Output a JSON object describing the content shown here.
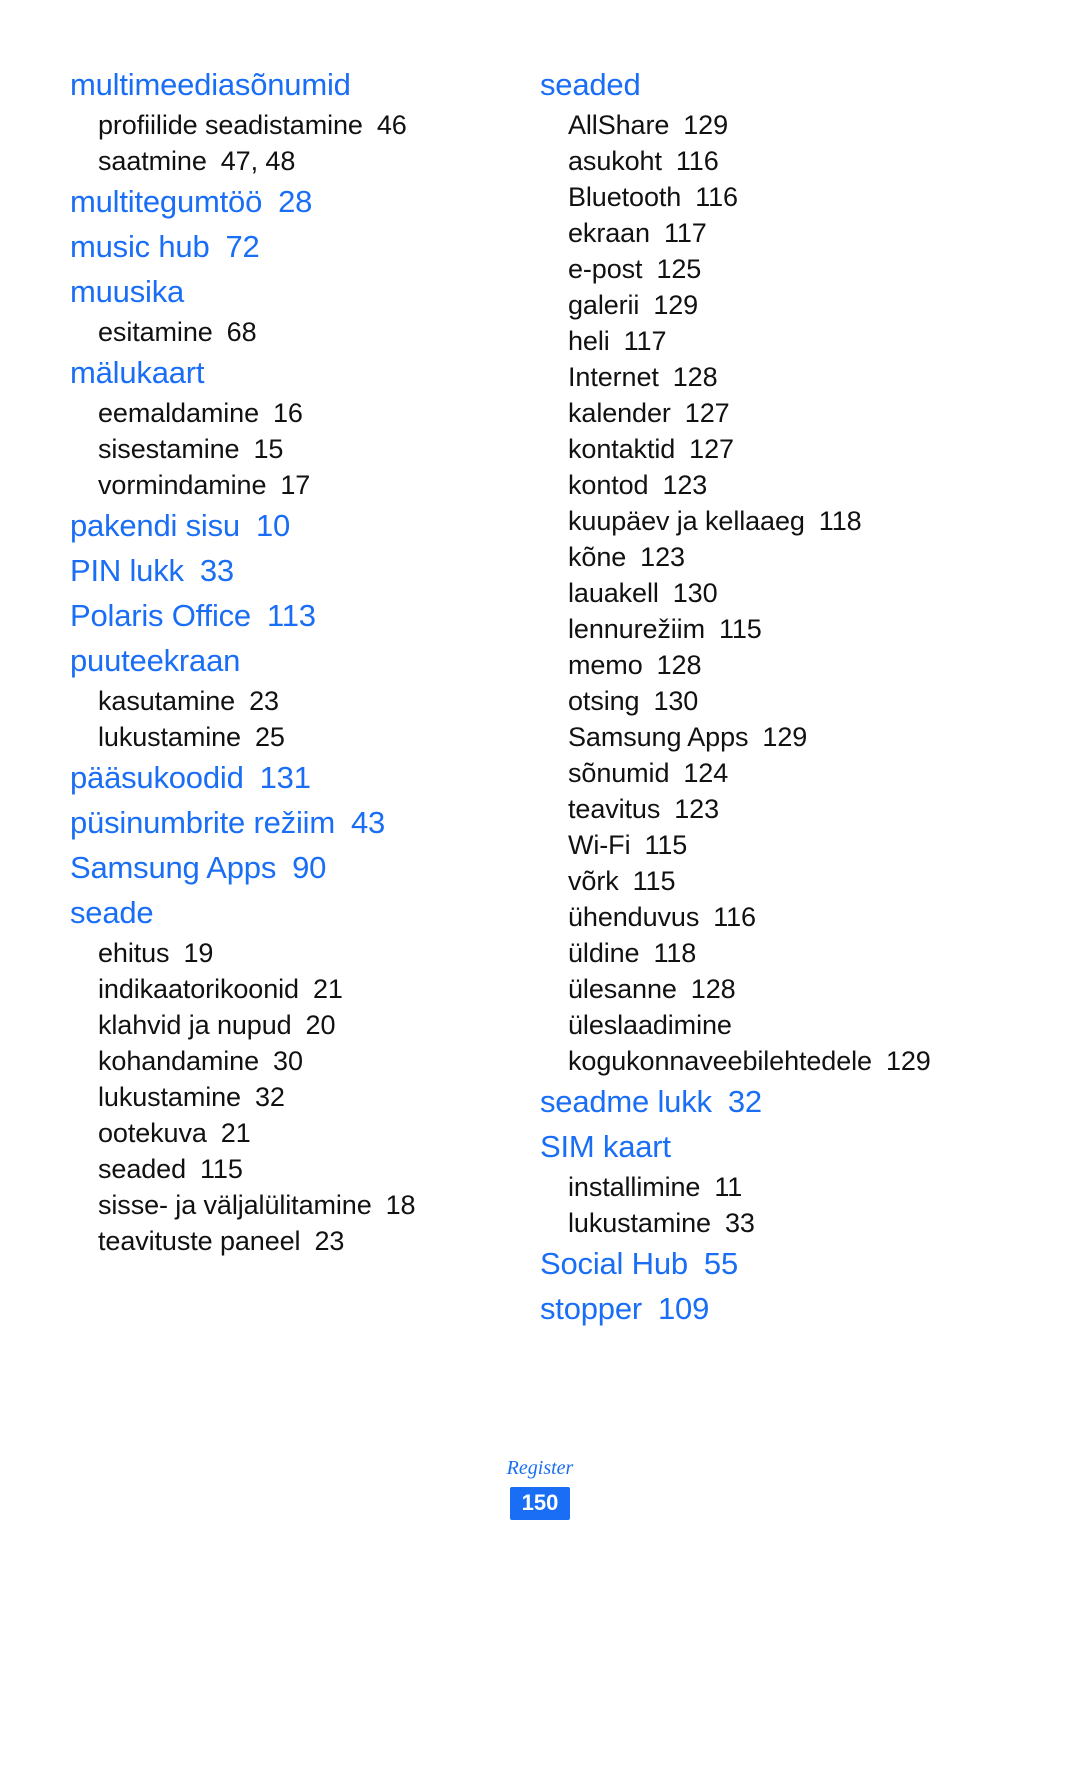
{
  "document": {
    "type": "index-page",
    "language": "Estonian",
    "footer_label": "Register",
    "page_number": "150",
    "accent_color": "#1a6ef5",
    "text_color": "#111111"
  },
  "left_column": [
    {
      "head": "multimeediasõnumid",
      "head_page": "",
      "subs": [
        {
          "label": "profiilide seadistamine",
          "page": "46"
        },
        {
          "label": "saatmine",
          "page": "47, 48"
        }
      ]
    },
    {
      "head": "multitegumtöö",
      "head_page": "28",
      "subs": []
    },
    {
      "head": "music hub",
      "head_page": "72",
      "subs": []
    },
    {
      "head": "muusika",
      "head_page": "",
      "subs": [
        {
          "label": "esitamine",
          "page": "68"
        }
      ]
    },
    {
      "head": "mälukaart",
      "head_page": "",
      "subs": [
        {
          "label": "eemaldamine",
          "page": "16"
        },
        {
          "label": "sisestamine",
          "page": "15"
        },
        {
          "label": "vormindamine",
          "page": "17"
        }
      ]
    },
    {
      "head": "pakendi sisu",
      "head_page": "10",
      "subs": []
    },
    {
      "head": "PIN lukk",
      "head_page": "33",
      "subs": []
    },
    {
      "head": "Polaris Office",
      "head_page": "113",
      "subs": []
    },
    {
      "head": "puuteekraan",
      "head_page": "",
      "subs": [
        {
          "label": "kasutamine",
          "page": "23"
        },
        {
          "label": "lukustamine",
          "page": "25"
        }
      ]
    },
    {
      "head": "pääsukoodid",
      "head_page": "131",
      "subs": []
    },
    {
      "head": "püsinumbrite režiim",
      "head_page": "43",
      "subs": []
    },
    {
      "head": "Samsung Apps",
      "head_page": "90",
      "subs": []
    },
    {
      "head": "seade",
      "head_page": "",
      "subs": [
        {
          "label": "ehitus",
          "page": "19"
        },
        {
          "label": "indikaatorikoonid",
          "page": "21"
        },
        {
          "label": "klahvid ja nupud",
          "page": "20"
        },
        {
          "label": "kohandamine",
          "page": "30"
        },
        {
          "label": "lukustamine",
          "page": "32"
        },
        {
          "label": "ootekuva",
          "page": "21"
        },
        {
          "label": "seaded",
          "page": "115"
        },
        {
          "label": "sisse- ja väljalülitamine",
          "page": "18"
        },
        {
          "label": "teavituste paneel",
          "page": "23"
        }
      ]
    }
  ],
  "right_column": [
    {
      "head": "seaded",
      "head_page": "",
      "subs": [
        {
          "label": "AllShare",
          "page": "129"
        },
        {
          "label": "asukoht",
          "page": "116"
        },
        {
          "label": "Bluetooth",
          "page": "116"
        },
        {
          "label": "ekraan",
          "page": "117"
        },
        {
          "label": "e-post",
          "page": "125"
        },
        {
          "label": "galerii",
          "page": "129"
        },
        {
          "label": "heli",
          "page": "117"
        },
        {
          "label": "Internet",
          "page": "128"
        },
        {
          "label": "kalender",
          "page": "127"
        },
        {
          "label": "kontaktid",
          "page": "127"
        },
        {
          "label": "kontod",
          "page": "123"
        },
        {
          "label": "kuupäev ja kellaaeg",
          "page": "118"
        },
        {
          "label": "kõne",
          "page": "123"
        },
        {
          "label": "lauakell",
          "page": "130"
        },
        {
          "label": "lennurežiim",
          "page": "115"
        },
        {
          "label": "memo",
          "page": "128"
        },
        {
          "label": "otsing",
          "page": "130"
        },
        {
          "label": "Samsung Apps",
          "page": "129"
        },
        {
          "label": "sõnumid",
          "page": "124"
        },
        {
          "label": "teavitus",
          "page": "123"
        },
        {
          "label": "Wi-Fi",
          "page": "115"
        },
        {
          "label": "võrk",
          "page": "115"
        },
        {
          "label": "ühenduvus",
          "page": "116"
        },
        {
          "label": "üldine",
          "page": "118"
        },
        {
          "label": "ülesanne",
          "page": "128"
        },
        {
          "label": "üleslaadimine",
          "page": "",
          "continuation": "kogukonnaveebilehtedele",
          "continuation_page": "129"
        }
      ]
    },
    {
      "head": "seadme lukk",
      "head_page": "32",
      "subs": []
    },
    {
      "head": "SIM kaart",
      "head_page": "",
      "subs": [
        {
          "label": "installimine",
          "page": "11"
        },
        {
          "label": "lukustamine",
          "page": "33"
        }
      ]
    },
    {
      "head": "Social Hub",
      "head_page": "55",
      "subs": []
    },
    {
      "head": "stopper",
      "head_page": "109",
      "subs": []
    }
  ]
}
